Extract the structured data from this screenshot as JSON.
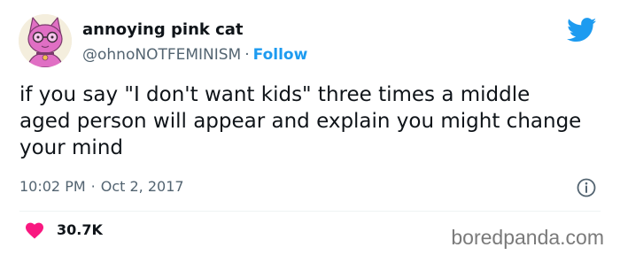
{
  "author": {
    "display_name": "annoying pink cat",
    "handle": "@ohnoNOTFEMINISM",
    "separator": "·",
    "follow_label": "Follow",
    "avatar_icon": "pink-cat-avatar-icon"
  },
  "tweet": {
    "text": "if you say \"I don't want kids\" three times a middle aged person will appear and explain you might change your mind",
    "time": "10:02 PM",
    "separator": "·",
    "date": "Oct 2, 2017"
  },
  "engagement": {
    "likes": "30.7K",
    "like_icon": "heart-icon"
  },
  "brand": {
    "platform_icon": "twitter-bird-icon",
    "info_icon": "info-icon",
    "watermark": "boredpanda.com"
  },
  "colors": {
    "accent": "#1d9bf0",
    "heart": "#f91880",
    "secondary_text": "#536471",
    "primary_text": "#0f1419"
  }
}
